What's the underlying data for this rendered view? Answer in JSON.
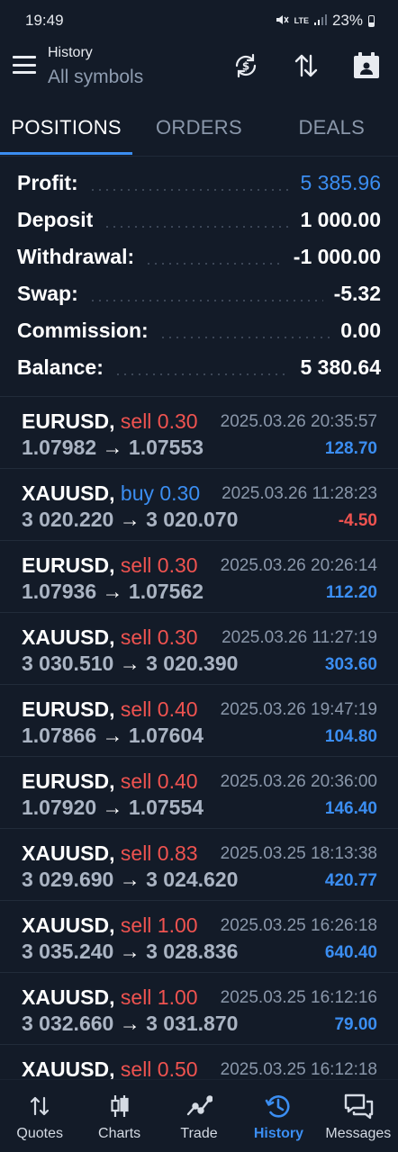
{
  "status_bar": {
    "time": "19:49",
    "battery": "23%",
    "network": "LTE"
  },
  "header": {
    "title": "History",
    "subtitle": "All symbols",
    "icons": [
      "menu-icon",
      "currency-sync-icon",
      "sort-icon",
      "calendar-icon"
    ]
  },
  "tabs": [
    {
      "label": "POSITIONS",
      "active": true
    },
    {
      "label": "ORDERS",
      "active": false
    },
    {
      "label": "DEALS",
      "active": false
    }
  ],
  "summary": {
    "profit_label": "Profit:",
    "profit_value": "5 385.96",
    "deposit_label": "Deposit",
    "deposit_value": "1 000.00",
    "withdrawal_label": "Withdrawal:",
    "withdrawal_value": "-1 000.00",
    "swap_label": "Swap:",
    "swap_value": "-5.32",
    "commission_label": "Commission:",
    "commission_value": "0.00",
    "balance_label": "Balance:",
    "balance_value": "5 380.64"
  },
  "positions": [
    {
      "symbol": "EURUSD,",
      "side": "sell 0.30",
      "side_type": "sell",
      "time": "2025.03.26 20:35:57",
      "open": "1.07982",
      "close": "1.07553",
      "pl": "128.70",
      "pl_sign": "pos"
    },
    {
      "symbol": "XAUUSD,",
      "side": "buy 0.30",
      "side_type": "buy",
      "time": "2025.03.26 11:28:23",
      "open": "3 020.220",
      "close": "3 020.070",
      "pl": "-4.50",
      "pl_sign": "neg"
    },
    {
      "symbol": "EURUSD,",
      "side": "sell 0.30",
      "side_type": "sell",
      "time": "2025.03.26 20:26:14",
      "open": "1.07936",
      "close": "1.07562",
      "pl": "112.20",
      "pl_sign": "pos"
    },
    {
      "symbol": "XAUUSD,",
      "side": "sell 0.30",
      "side_type": "sell",
      "time": "2025.03.26 11:27:19",
      "open": "3 030.510",
      "close": "3 020.390",
      "pl": "303.60",
      "pl_sign": "pos"
    },
    {
      "symbol": "EURUSD,",
      "side": "sell 0.40",
      "side_type": "sell",
      "time": "2025.03.26 19:47:19",
      "open": "1.07866",
      "close": "1.07604",
      "pl": "104.80",
      "pl_sign": "pos"
    },
    {
      "symbol": "EURUSD,",
      "side": "sell 0.40",
      "side_type": "sell",
      "time": "2025.03.26 20:36:00",
      "open": "1.07920",
      "close": "1.07554",
      "pl": "146.40",
      "pl_sign": "pos"
    },
    {
      "symbol": "XAUUSD,",
      "side": "sell 0.83",
      "side_type": "sell",
      "time": "2025.03.25 18:13:38",
      "open": "3 029.690",
      "close": "3 024.620",
      "pl": "420.77",
      "pl_sign": "pos"
    },
    {
      "symbol": "XAUUSD,",
      "side": "sell 1.00",
      "side_type": "sell",
      "time": "2025.03.25 16:26:18",
      "open": "3 035.240",
      "close": "3 028.836",
      "pl": "640.40",
      "pl_sign": "pos"
    },
    {
      "symbol": "XAUUSD,",
      "side": "sell 1.00",
      "side_type": "sell",
      "time": "2025.03.25 16:12:16",
      "open": "3 032.660",
      "close": "3 031.870",
      "pl": "79.00",
      "pl_sign": "pos"
    },
    {
      "symbol": "XAUUSD,",
      "side": "sell 0.50",
      "side_type": "sell",
      "time": "2025.03.25 16:12:18",
      "open": "",
      "close": "",
      "pl": "",
      "pl_sign": "pos"
    }
  ],
  "arrow": "→",
  "bottom_nav": [
    {
      "label": "Quotes",
      "icon": "quotes-icon",
      "active": false
    },
    {
      "label": "Charts",
      "icon": "charts-icon",
      "active": false
    },
    {
      "label": "Trade",
      "icon": "trade-icon",
      "active": false
    },
    {
      "label": "History",
      "icon": "history-icon",
      "active": true
    },
    {
      "label": "Messages",
      "icon": "messages-icon",
      "active": false
    }
  ],
  "colors": {
    "background": "#131b28",
    "accent": "#3b8ef2",
    "sell": "#ef5350",
    "muted": "#8a97aa"
  }
}
